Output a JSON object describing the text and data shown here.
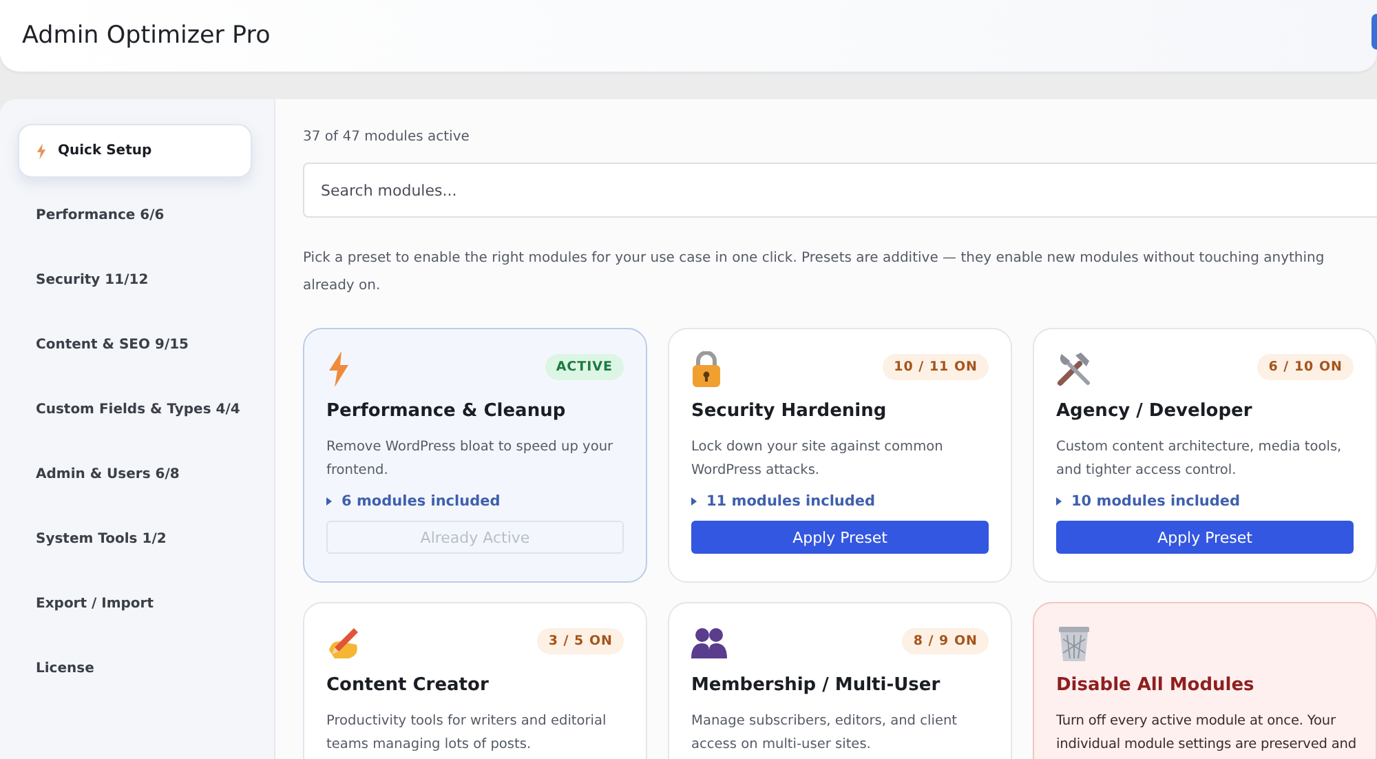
{
  "app": {
    "title": "Admin Optimizer Pro"
  },
  "sidebar": {
    "items": [
      {
        "label": "Quick Setup",
        "selected": true
      },
      {
        "label": "Performance 6/6",
        "selected": false
      },
      {
        "label": "Security 11/12",
        "selected": false
      },
      {
        "label": "Content & SEO 9/15",
        "selected": false
      },
      {
        "label": "Custom Fields & Types 4/4",
        "selected": false
      },
      {
        "label": "Admin & Users 6/8",
        "selected": false
      },
      {
        "label": "System Tools 1/2",
        "selected": false
      },
      {
        "label": "Export / Import",
        "selected": false
      },
      {
        "label": "License",
        "selected": false
      }
    ]
  },
  "status": "37 of 47 modules active",
  "search": {
    "placeholder": "Search modules..."
  },
  "intro": "Pick a preset to enable the right modules for your use case in one click. Presets are additive — they enable new modules without touching anything already on.",
  "presets": [
    {
      "kind": "preset",
      "title": "Performance & Cleanup",
      "description": "Remove WordPress bloat to speed up your frontend.",
      "badge": "ACTIVE",
      "active": true,
      "modules": "6 modules included",
      "button": {
        "label": "Already Active",
        "disabled": true
      }
    },
    {
      "kind": "preset",
      "title": "Security Hardening",
      "description": "Lock down your site against common WordPress attacks.",
      "badge": "10 / 11 ON",
      "active": false,
      "modules": "11 modules included",
      "button": {
        "label": "Apply Preset",
        "disabled": false
      }
    },
    {
      "kind": "preset",
      "title": "Agency / Developer",
      "description": "Custom content architecture, media tools, and tighter access control.",
      "badge": "6 / 10 ON",
      "active": false,
      "modules": "10 modules included",
      "button": {
        "label": "Apply Preset",
        "disabled": false
      }
    },
    {
      "kind": "preset",
      "title": "Content Creator",
      "description": "Productivity tools for writers and editorial teams managing lots of posts.",
      "badge": "3 / 5 ON",
      "active": false
    },
    {
      "kind": "preset",
      "title": "Membership / Multi-User",
      "description": "Manage subscribers, editors, and client access on multi-user sites.",
      "badge": "8 / 9 ON",
      "active": false
    },
    {
      "kind": "danger",
      "title": "Disable All Modules",
      "description": "Turn off every active module at once. Your individual module settings are preserved and"
    }
  ]
}
